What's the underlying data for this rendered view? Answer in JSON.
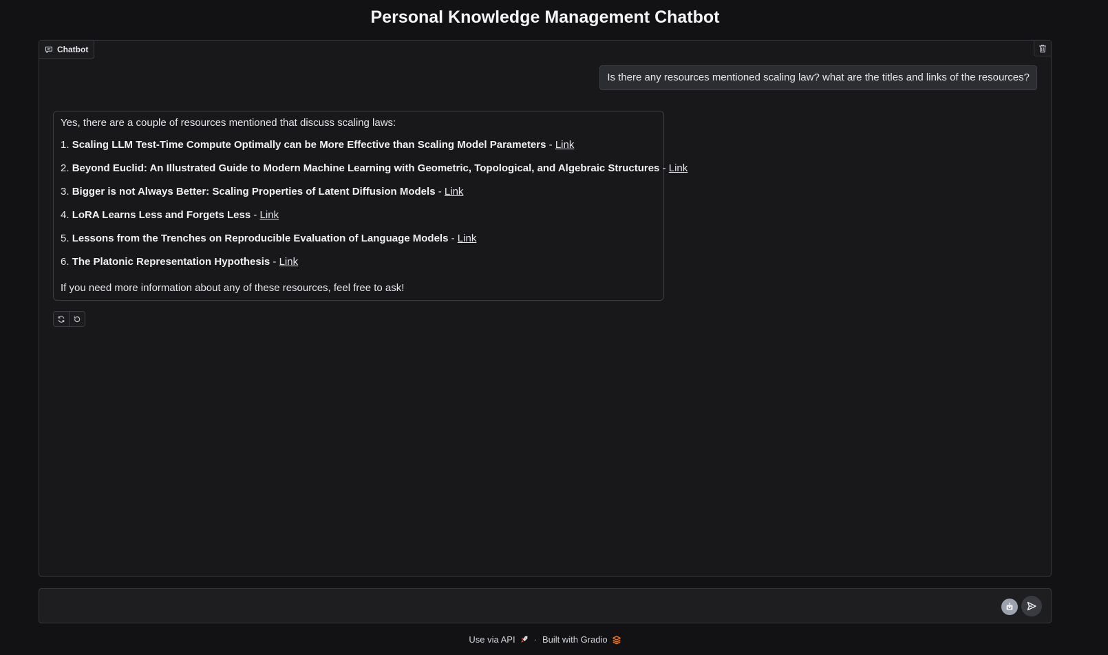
{
  "page": {
    "title": "Personal Knowledge Management Chatbot"
  },
  "chatbot": {
    "label": "Chatbot",
    "user_message": "Is there any resources mentioned scaling law? what are the titles and links of the resources?",
    "bot_message": {
      "intro": "Yes, there are a couple of resources mentioned that discuss scaling laws:",
      "separator": " - ",
      "link_text": "Link",
      "items": [
        {
          "number": "1.",
          "title": "Scaling LLM Test-Time Compute Optimally can be More Effective than Scaling Model Parameters"
        },
        {
          "number": "2.",
          "title": "Beyond Euclid: An Illustrated Guide to Modern Machine Learning with Geometric, Topological, and Algebraic Structures"
        },
        {
          "number": "3.",
          "title": "Bigger is not Always Better: Scaling Properties of Latent Diffusion Models"
        },
        {
          "number": "4.",
          "title": "LoRA Learns Less and Forgets Less"
        },
        {
          "number": "5.",
          "title": "Lessons from the Trenches on Reproducible Evaluation of Language Models"
        },
        {
          "number": "6.",
          "title": "The Platonic Representation Hypothesis"
        }
      ],
      "outro": "If you need more information about any of these resources, feel free to ask!"
    },
    "icons": {
      "label": "chat-bubble-icon",
      "clear": "trash-icon",
      "retry": "retry-icon",
      "undo": "undo-icon"
    }
  },
  "input": {
    "value": "",
    "placeholder": "",
    "icons": [
      "robot-icon",
      "send-icon"
    ]
  },
  "footer": {
    "api_label": "Use via API",
    "separator": "·",
    "built_label": "Built with Gradio"
  },
  "colors": {
    "background": "#121214",
    "panel": "#18181b",
    "user_bubble": "#2c2d31",
    "gradio_orange": "#f97316"
  }
}
